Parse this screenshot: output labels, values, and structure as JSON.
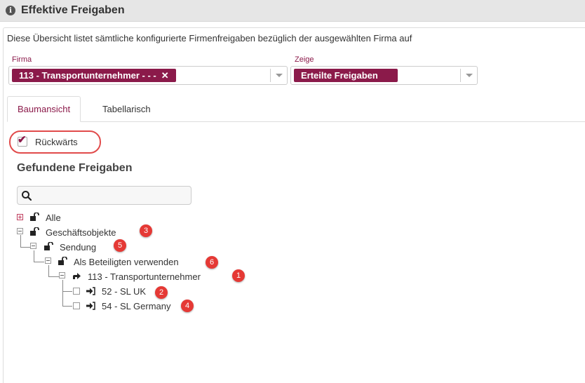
{
  "header": {
    "title": "Effektive Freigaben",
    "icon": "info-icon"
  },
  "description": "Diese Übersicht listet sämtliche konfigurierte Firmenfreigaben bezüglich der ausgewählten Firma auf",
  "firma": {
    "label": "Firma",
    "value": "113 - Transportunternehmer - - -",
    "remove": "✕"
  },
  "zeige": {
    "label": "Zeige",
    "value": "Erteilte Freigaben"
  },
  "tabs": [
    {
      "label": "Baumansicht",
      "active": true
    },
    {
      "label": "Tabellarisch",
      "active": false
    }
  ],
  "rueckwaerts": {
    "label": "Rückwärts",
    "checked": true
  },
  "found_title": "Gefundene Freigaben",
  "search": {
    "placeholder": ""
  },
  "tree": [
    {
      "label": "Alle",
      "icon": "unlock-icon",
      "expander": "plus"
    },
    {
      "label": "Geschäftsobjekte",
      "icon": "unlock-icon",
      "expander": "minus",
      "badge": "3"
    },
    {
      "label": "Sendung",
      "icon": "unlock-icon",
      "expander": "minus",
      "badge": "5"
    },
    {
      "label": "Als Beteiligten verwenden",
      "icon": "unlock-icon",
      "expander": "minus",
      "badge": "6"
    },
    {
      "label": "113 - Transportunternehmer",
      "icon": "share-arrow-icon",
      "expander": "minus",
      "badge": "1"
    },
    {
      "label": "52 - SL UK",
      "icon": "sign-in-icon",
      "checkbox": true,
      "badge": "2"
    },
    {
      "label": "54 - SL Germany",
      "icon": "sign-in-icon",
      "checkbox": true,
      "badge": "4"
    }
  ],
  "colors": {
    "accent": "#8b1a4a",
    "badge": "#e53935"
  }
}
